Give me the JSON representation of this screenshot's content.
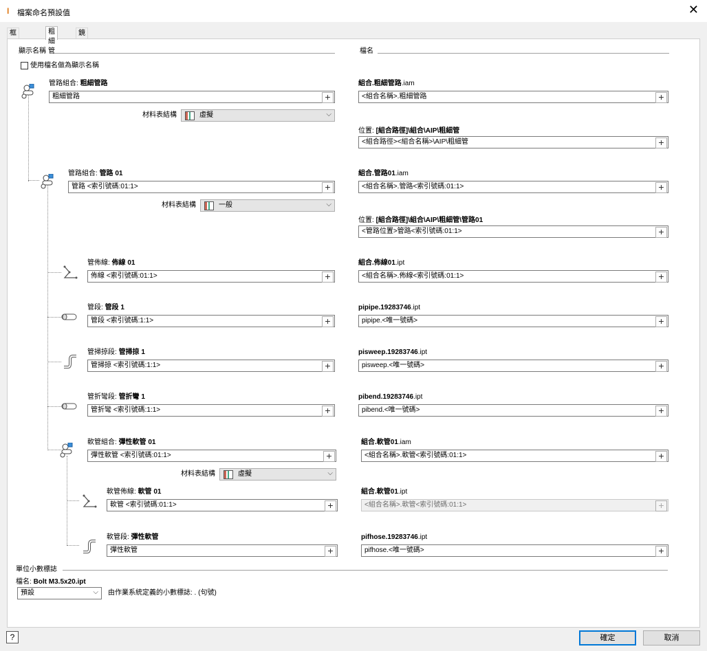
{
  "window": {
    "title": "檔案命名預設值",
    "close_glyph": "✕"
  },
  "tabs": [
    "框架產生器",
    "粗細管",
    "鏡射和複製"
  ],
  "sections": {
    "display_name": "顯示名稱",
    "file_name": "檔名",
    "unit_decimal": "單位小數標誌"
  },
  "use_filename_checkbox": {
    "label": "使用檔名做為顯示名稱",
    "checked": false
  },
  "bom_label": "材料表結構",
  "plus_glyph": "+",
  "combo_arrow": "⌵",
  "nodes": [
    {
      "kind": "assembly",
      "prefix": "管路組合: ",
      "name": "粗細管路",
      "value": "粗細管路",
      "bom": "虛擬",
      "file_bold": "組合.粗細管路",
      "file_ext": ".iam",
      "file_value": "<組合名稱>.粗細管路",
      "loc_prefix": "位置: ",
      "loc_bold": "[組合路徑]\\組合\\AIP\\粗細管",
      "loc_value": "<組合路徑><組合名稱>\\AIP\\粗細管"
    },
    {
      "kind": "assembly",
      "prefix": "管路組合: ",
      "name": "管路 01",
      "value": "管路 <索引號碼:01:1>",
      "bom": "一般",
      "file_bold": "組合.管路01",
      "file_ext": ".iam",
      "file_value": "<組合名稱>.管路<索引號碼:01:1>",
      "loc_prefix": "位置: ",
      "loc_bold": "[組合路徑]\\組合\\AIP\\粗細管\\管路01",
      "loc_value": "<管路位置>管路<索引號碼:01:1>"
    },
    {
      "kind": "route",
      "prefix": "管佈線: ",
      "name": "佈線 01",
      "value": "佈線 <索引號碼:01:1>",
      "file_bold": "組合.佈線01",
      "file_ext": ".ipt",
      "file_value": "<組合名稱>.佈線<索引號碼:01:1>"
    },
    {
      "kind": "segment",
      "prefix": "管段: ",
      "name": "管段 1",
      "value": "管段 <索引號碼:1:1>",
      "file_bold": "pipipe.19283746",
      "file_ext": ".ipt",
      "file_value": "pipipe.<唯一號碼>"
    },
    {
      "kind": "sweep",
      "prefix": "管掃掠段: ",
      "name": "管掃掠 1",
      "value": "管掃掠 <索引號碼:1:1>",
      "file_bold": "pisweep.19283746",
      "file_ext": ".ipt",
      "file_value": "pisweep.<唯一號碼>"
    },
    {
      "kind": "segment",
      "prefix": "管折彎段: ",
      "name": "管折彎 1",
      "value": "管折彎 <索引號碼:1:1>",
      "file_bold": "pibend.19283746",
      "file_ext": ".ipt",
      "file_value": "pibend.<唯一號碼>"
    },
    {
      "kind": "assembly",
      "prefix": "軟管組合: ",
      "name": "彈性軟管 01",
      "value": "彈性軟管 <索引號碼:01:1>",
      "bom": "虛擬",
      "file_bold": "組合.軟管01",
      "file_ext": ".iam",
      "file_value": "<組合名稱>.軟管<索引號碼:01:1>"
    },
    {
      "kind": "route",
      "prefix": "軟管佈線: ",
      "name": "軟管 01",
      "value": "軟管 <索引號碼:01:1>",
      "file_bold": "組合.軟管01",
      "file_ext": ".ipt",
      "file_value": "<組合名稱>.軟管<索引號碼:01:1>",
      "file_disabled": true
    },
    {
      "kind": "sweep",
      "prefix": "軟管段: ",
      "name": "彈性軟管",
      "value": "彈性軟管",
      "file_bold": "pifhose.19283746",
      "file_ext": ".ipt",
      "file_value": "pifhose.<唯一號碼>"
    }
  ],
  "unit": {
    "file_label": "檔名: ",
    "file_example": "Bolt M3.5x20.ipt",
    "select_value": "預設",
    "description": "由作業系統定義的小數標誌: . (句號)"
  },
  "footer": {
    "help": "?",
    "ok": "確定",
    "cancel": "取消"
  }
}
